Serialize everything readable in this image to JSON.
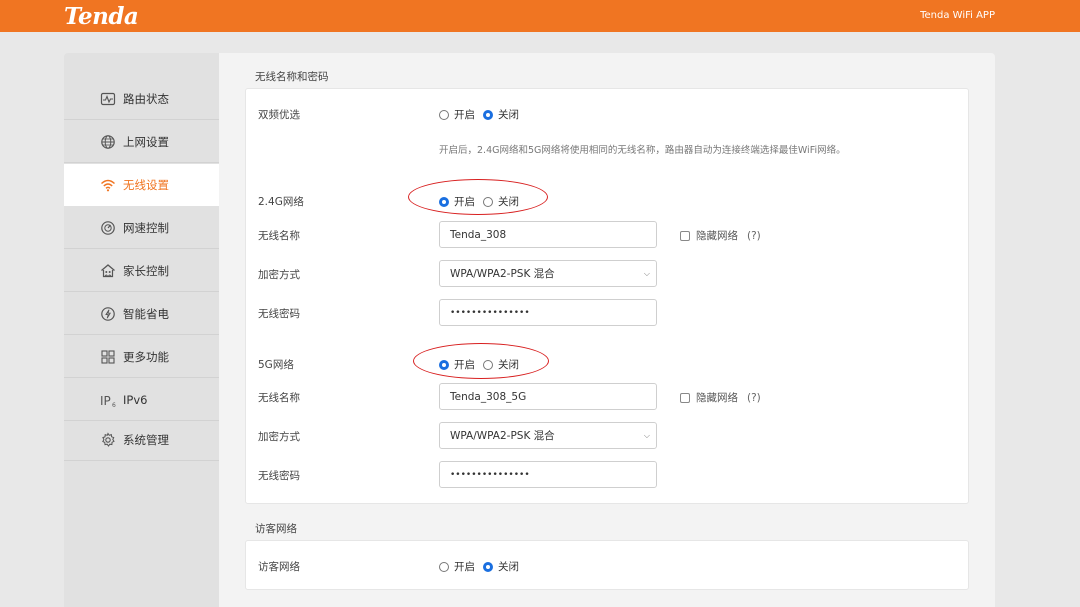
{
  "header": {
    "logo": "Tenda",
    "app_link": "Tenda WiFi APP"
  },
  "sidebar": {
    "items": [
      {
        "label": "路由状态",
        "icon": "status-monitor-icon"
      },
      {
        "label": "上网设置",
        "icon": "globe-icon"
      },
      {
        "label": "无线设置",
        "icon": "wifi-icon",
        "active": true
      },
      {
        "label": "网速控制",
        "icon": "speedometer-icon"
      },
      {
        "label": "家长控制",
        "icon": "parental-home-icon"
      },
      {
        "label": "智能省电",
        "icon": "power-save-icon"
      },
      {
        "label": "更多功能",
        "icon": "grid-icon"
      },
      {
        "label": "IPv6",
        "icon": "ipv6-icon"
      },
      {
        "label": "系统管理",
        "icon": "gear-icon"
      }
    ]
  },
  "wireless": {
    "section_title": "无线名称和密码",
    "dual_band": {
      "label": "双频优选",
      "on_label": "开启",
      "off_label": "关闭",
      "selected": "off",
      "hint": "开启后，2.4G网络和5G网络将使用相同的无线名称，路由器自动为连接终端选择最佳WiFi网络。"
    },
    "band_24": {
      "label": "2.4G网络",
      "on_label": "开启",
      "off_label": "关闭",
      "selected": "on",
      "ssid_label": "无线名称",
      "ssid": "Tenda_308",
      "hide_label": "隐藏网络",
      "help": "(?)",
      "enc_label": "加密方式",
      "encryption": "WPA/WPA2-PSK 混合",
      "pwd_label": "无线密码",
      "password": "•••••••••••••••"
    },
    "band_5": {
      "label": "5G网络",
      "on_label": "开启",
      "off_label": "关闭",
      "selected": "on",
      "ssid_label": "无线名称",
      "ssid": "Tenda_308_5G",
      "hide_label": "隐藏网络",
      "help": "(?)",
      "enc_label": "加密方式",
      "encryption": "WPA/WPA2-PSK 混合",
      "pwd_label": "无线密码",
      "password": "•••••••••••••••"
    }
  },
  "guest": {
    "section_title": "访客网络",
    "label": "访客网络",
    "on_label": "开启",
    "off_label": "关闭",
    "selected": "off"
  },
  "colors": {
    "brand": "#f07522",
    "radio_checked": "#1a6fe0",
    "annotation": "#d82020"
  }
}
